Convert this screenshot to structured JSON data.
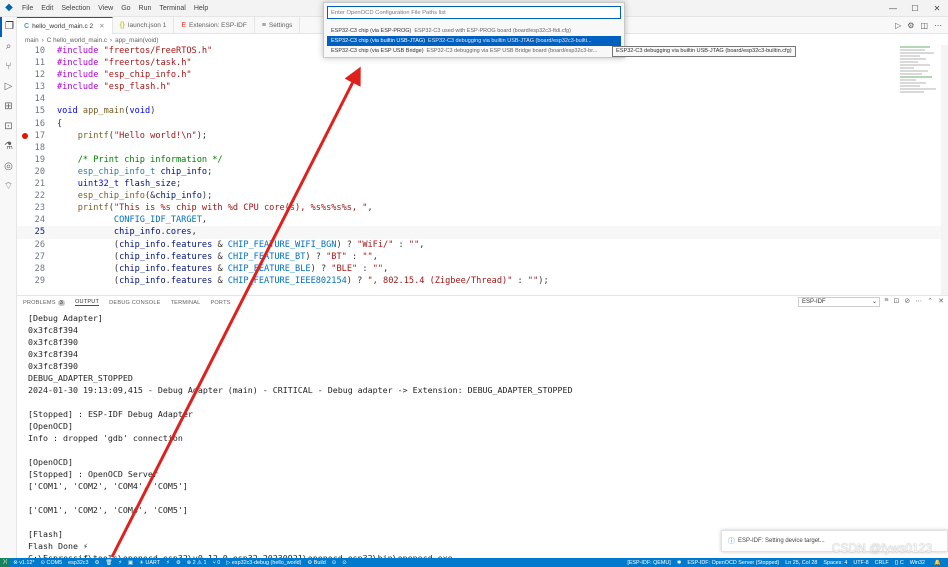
{
  "menu": [
    "File",
    "Edit",
    "Selection",
    "View",
    "Go",
    "Run",
    "Terminal",
    "Help"
  ],
  "tabs": [
    {
      "label": "hello_world_main.c 2",
      "icon": "C",
      "active": true
    },
    {
      "label": "launch.json 1",
      "icon": "{}",
      "active": false
    },
    {
      "label": "Extension: ESP-IDF",
      "icon": "E",
      "active": false
    },
    {
      "label": "Settings",
      "icon": "≡",
      "active": false
    }
  ],
  "breadcrumb": [
    "main",
    "C  hello_world_main.c",
    "app_main(void)"
  ],
  "editor": {
    "lines": [
      {
        "n": "10",
        "code": "#include \"freertos/FreeRTOS.h\""
      },
      {
        "n": "11",
        "code": "#include \"freertos/task.h\""
      },
      {
        "n": "12",
        "code": "#include \"esp_chip_info.h\""
      },
      {
        "n": "13",
        "code": "#include \"esp_flash.h\""
      },
      {
        "n": "14",
        "code": ""
      },
      {
        "n": "15",
        "code": "void app_main(void)"
      },
      {
        "n": "16",
        "code": "{"
      },
      {
        "n": "17",
        "code": "    printf(\"Hello world!\\n\");"
      },
      {
        "n": "18",
        "code": ""
      },
      {
        "n": "19",
        "code": "    /* Print chip information */"
      },
      {
        "n": "20",
        "code": "    esp_chip_info_t chip_info;"
      },
      {
        "n": "21",
        "code": "    uint32_t flash_size;"
      },
      {
        "n": "22",
        "code": "    esp_chip_info(&chip_info);"
      },
      {
        "n": "23",
        "code": "    printf(\"This is %s chip with %d CPU core(s), %s%s%s%s, \","
      },
      {
        "n": "24",
        "code": "           CONFIG_IDF_TARGET,"
      },
      {
        "n": "25",
        "code": "           chip_info.cores,"
      },
      {
        "n": "26",
        "code": "           (chip_info.features & CHIP_FEATURE_WIFI_BGN) ? \"WiFi/\" : \"\","
      },
      {
        "n": "27",
        "code": "           (chip_info.features & CHIP_FEATURE_BT) ? \"BT\" : \"\","
      },
      {
        "n": "28",
        "code": "           (chip_info.features & CHIP_FEATURE_BLE) ? \"BLE\" : \"\","
      },
      {
        "n": "29",
        "code": "           (chip_info.features & CHIP_FEATURE_IEEE802154) ? \", 802.15.4 (Zigbee/Thread)\" : \"\");"
      }
    ]
  },
  "panel": {
    "tabs": [
      {
        "label": "PROBLEMS",
        "badge": "3"
      },
      {
        "label": "OUTPUT",
        "badge": ""
      },
      {
        "label": "DEBUG CONSOLE",
        "badge": ""
      },
      {
        "label": "TERMINAL",
        "badge": ""
      },
      {
        "label": "PORTS",
        "badge": ""
      }
    ],
    "channel": "ESP-IDF",
    "output": [
      "[Debug Adapter]",
      "0x3fc8f394",
      "0x3fc8f390",
      "0x3fc8f394",
      "0x3fc8f390",
      "DEBUG_ADAPTER_STOPPED",
      "2024-01-30 19:13:09,415 - Debug Adapter (main) - CRITICAL - Debug adapter -> Extension: DEBUG_ADAPTER_STOPPED",
      "",
      "[Stopped] : ESP-IDF Debug Adapter",
      "[OpenOCD]",
      "Info : dropped 'gdb' connection",
      "",
      "[OpenOCD]",
      "[Stopped] : OpenOCD Server",
      "['COM1', 'COM2', 'COM4', 'COM5']",
      "",
      "['COM1', 'COM2', 'COM4', 'COM5']",
      "",
      "[Flash]",
      "Flash Done ⚡",
      "C:\\Espressif\\tools\\openocd-esp32\\v0.12.0-esp32-20230921\\openocd-esp32\\bin\\openocd.exe"
    ]
  },
  "quickpick": {
    "placeholder": "Enter OpenOCD Configuration File Paths list",
    "items": [
      {
        "label": "ESP32-C3 chip (via ESP-PROG)",
        "desc": "ESP32-C3 used with ESP-PROG board (board/esp32c3-ftdi.cfg)",
        "selected": false
      },
      {
        "label": "ESP32-C3 chip (via builtin USB-JTAG)",
        "desc": "ESP32-C3 debugging via builtin USB-JTAG (board/esp32c3-builti...",
        "selected": true
      },
      {
        "label": "ESP32-C3 chip (via ESP USB Bridge)",
        "desc": "ESP32-C3 debugging via ESP USB Bridge board (board/esp32c3-br...",
        "selected": false
      }
    ],
    "tooltip": "ESP32-C3 debugging via builtin USB-JTAG (board/esp32c3-builtin.cfg)"
  },
  "toast": {
    "text": "ESP-IDF: Setting device target..."
  },
  "statusbar": {
    "left": [
      "⊗ v1.12*",
      "⊙ COM5",
      "esp32c3",
      "⚙",
      "🗑",
      "⚡",
      "▣",
      "☀ UART",
      "⚡",
      "⚙",
      "⊗ 2 ⚠ 1",
      "⑂ 0",
      "▷ esp32c3-debug (hello_world)",
      "⚙ Build",
      "⊙",
      "⊙"
    ],
    "right": [
      "[ESP-IDF: QEMU]",
      "✱",
      "ESP-IDF: OpenOCD Server (Stopped)",
      "Ln 25, Col 28",
      "Spaces: 4",
      "UTF-8",
      "CRLF",
      "{} C",
      "Win32"
    ]
  },
  "watermark": "CSDN @fyws0123",
  "colors": {
    "accent": "#005fb8",
    "statusbar": "#007acc",
    "arrow": "#e0201c",
    "breakpoint": "#e51400"
  }
}
